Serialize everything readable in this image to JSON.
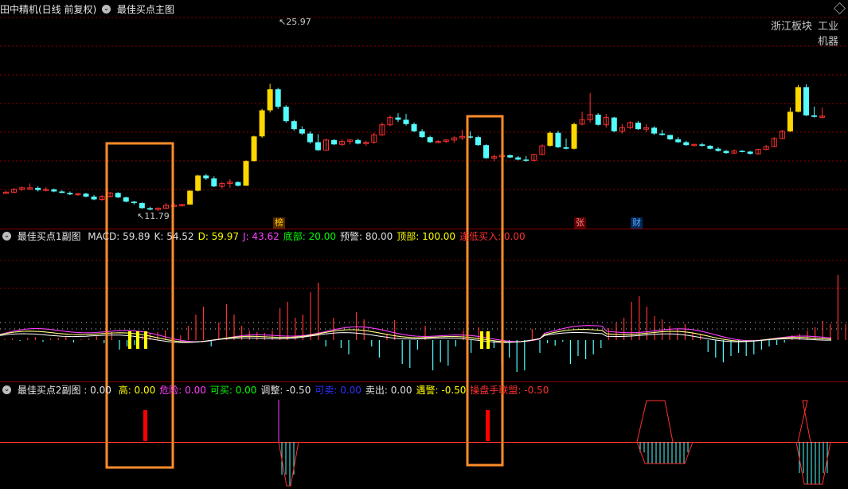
{
  "main_header": {
    "stock": "田中精机(日线 前复权)",
    "indicator": "最佳买点主图"
  },
  "labels": {
    "high": "25.97",
    "low": "11.79",
    "right_a": "浙江板块",
    "right_b": "工业机器"
  },
  "tags": {
    "bang": "榜",
    "zhang": "张",
    "cai": "财"
  },
  "sub1": {
    "name": "最佳买点1副图",
    "items": [
      {
        "label": "MACD: 59.89",
        "color": "#e0e0e0"
      },
      {
        "label": "K: 54.52",
        "color": "#e0e0e0"
      },
      {
        "label": "D: 59.97",
        "color": "#ffff00"
      },
      {
        "label": "J: 43.62",
        "color": "#ff40ff"
      },
      {
        "label": "底部: 20.00",
        "color": "#00ff00"
      },
      {
        "label": "预警: 80.00",
        "color": "#e0e0e0"
      },
      {
        "label": "顶部: 100.00",
        "color": "#ffff00"
      },
      {
        "label": "逢低买入: 0.00",
        "color": "#ff3030"
      }
    ]
  },
  "sub2": {
    "name": "最佳买点2副图 : 0.00",
    "items": [
      {
        "label": "高: 0.00",
        "color": "#ffff00"
      },
      {
        "label": "危险: 0.00",
        "color": "#ff40ff"
      },
      {
        "label": "可买: 0.00",
        "color": "#00ff00"
      },
      {
        "label": "调整: -0.50",
        "color": "#e0e0e0"
      },
      {
        "label": "可卖: 0.00",
        "color": "#3030ff"
      },
      {
        "label": "卖出: 0.00",
        "color": "#e0e0e0"
      },
      {
        "label": "遇警: -0.50",
        "color": "#ffff00"
      },
      {
        "label": "操盘手联盟: -0.50",
        "color": "#ff3030"
      }
    ]
  },
  "colors": {
    "up": "#ff3030",
    "down": "#54fcfc",
    "bigUp": "#ffd700",
    "box": "#ff8c2a",
    "grid": "#8b0000"
  },
  "candles": [
    [
      10.9,
      11.2,
      10.8,
      11.0
    ],
    [
      11.0,
      11.6,
      10.9,
      11.4
    ],
    [
      11.4,
      11.8,
      11.2,
      11.6
    ],
    [
      11.6,
      12.2,
      11.5,
      11.6
    ],
    [
      11.6,
      11.8,
      11.1,
      11.3
    ],
    [
      11.3,
      11.7,
      11.1,
      11.4
    ],
    [
      11.4,
      11.5,
      11.0,
      11.1
    ],
    [
      11.1,
      11.3,
      10.9,
      10.9
    ],
    [
      10.9,
      11.1,
      10.6,
      10.7
    ],
    [
      10.7,
      10.9,
      10.5,
      10.8
    ],
    [
      10.8,
      10.9,
      10.3,
      10.4
    ],
    [
      10.4,
      10.6,
      9.9,
      10.0
    ],
    [
      10.0,
      10.6,
      9.8,
      10.4
    ],
    [
      10.4,
      11.0,
      10.3,
      10.9
    ],
    [
      10.9,
      11.0,
      10.2,
      10.3
    ],
    [
      10.3,
      10.4,
      9.6,
      9.7
    ],
    [
      9.7,
      9.8,
      9.3,
      9.5
    ],
    [
      9.5,
      9.6,
      8.7,
      8.8
    ],
    [
      8.8,
      9.0,
      8.5,
      8.6
    ],
    [
      8.6,
      8.9,
      8.4,
      8.8
    ],
    [
      8.8,
      9.5,
      8.7,
      9.2
    ],
    [
      9.2,
      9.5,
      9.1,
      9.2
    ],
    [
      9.2,
      9.4,
      9.0,
      9.3
    ],
    [
      9.3,
      11.3,
      9.3,
      11.2
    ],
    [
      11.2,
      13.4,
      11.1,
      13.3
    ],
    [
      13.3,
      13.5,
      12.7,
      12.9
    ],
    [
      12.9,
      13.2,
      11.7,
      11.8
    ],
    [
      11.8,
      12.4,
      11.5,
      12.2
    ],
    [
      12.2,
      12.8,
      11.6,
      12.4
    ],
    [
      12.4,
      12.5,
      11.8,
      11.9
    ],
    [
      11.9,
      15.4,
      11.9,
      15.3
    ],
    [
      15.3,
      18.8,
      15.2,
      18.7
    ],
    [
      18.7,
      22.5,
      18.5,
      22.3
    ],
    [
      22.3,
      25.97,
      22.0,
      25.2
    ],
    [
      25.2,
      25.4,
      22.5,
      22.8
    ],
    [
      22.8,
      23.0,
      20.6,
      20.8
    ],
    [
      20.8,
      21.0,
      19.5,
      19.7
    ],
    [
      19.7,
      20.1,
      18.9,
      19.1
    ],
    [
      19.1,
      19.4,
      17.7,
      17.9
    ],
    [
      17.9,
      19.0,
      16.7,
      16.8
    ],
    [
      16.8,
      18.4,
      16.8,
      18.2
    ],
    [
      18.2,
      18.3,
      17.5,
      17.6
    ],
    [
      17.6,
      18.3,
      17.4,
      18.0
    ],
    [
      18.0,
      18.3,
      17.6,
      18.2
    ],
    [
      18.2,
      18.4,
      17.6,
      17.7
    ],
    [
      17.7,
      18.1,
      17.4,
      17.9
    ],
    [
      17.9,
      19.2,
      17.7,
      18.9
    ],
    [
      18.9,
      20.6,
      18.8,
      20.3
    ],
    [
      20.3,
      21.6,
      20.1,
      21.3
    ],
    [
      21.3,
      21.9,
      20.7,
      21.0
    ],
    [
      21.0,
      21.8,
      20.2,
      20.4
    ],
    [
      20.4,
      20.6,
      19.3,
      19.4
    ],
    [
      19.4,
      19.7,
      18.5,
      18.6
    ],
    [
      18.6,
      18.8,
      17.8,
      17.9
    ],
    [
      17.9,
      18.2,
      17.8,
      18.0
    ],
    [
      18.0,
      18.3,
      17.8,
      18.2
    ],
    [
      18.2,
      18.7,
      17.8,
      18.5
    ],
    [
      18.5,
      19.6,
      18.2,
      18.7
    ],
    [
      18.7,
      19.4,
      18.4,
      18.6
    ],
    [
      18.6,
      18.8,
      17.4,
      17.5
    ],
    [
      17.5,
      17.6,
      15.6,
      15.7
    ],
    [
      15.7,
      16.2,
      15.3,
      15.9
    ],
    [
      15.9,
      16.4,
      15.7,
      16.1
    ],
    [
      16.1,
      16.2,
      15.7,
      15.8
    ],
    [
      15.8,
      16.0,
      15.4,
      15.5
    ],
    [
      15.5,
      16.0,
      15.2,
      15.4
    ],
    [
      15.4,
      16.3,
      15.3,
      16.2
    ],
    [
      16.2,
      17.6,
      16.1,
      17.4
    ],
    [
      17.4,
      19.4,
      17.3,
      19.2
    ],
    [
      19.2,
      19.5,
      17.1,
      17.2
    ],
    [
      17.2,
      18.4,
      16.9,
      17.0
    ],
    [
      17.0,
      20.6,
      16.9,
      20.4
    ],
    [
      20.4,
      22.1,
      20.2,
      21.0
    ],
    [
      21.0,
      24.7,
      20.6,
      21.7
    ],
    [
      21.7,
      21.9,
      20.2,
      20.3
    ],
    [
      20.3,
      21.8,
      19.9,
      21.3
    ],
    [
      21.3,
      21.4,
      19.3,
      19.4
    ],
    [
      19.4,
      20.4,
      19.1,
      19.9
    ],
    [
      19.9,
      20.8,
      19.7,
      20.6
    ],
    [
      20.6,
      20.8,
      19.6,
      19.7
    ],
    [
      19.7,
      20.4,
      19.3,
      19.9
    ],
    [
      19.9,
      20.1,
      18.9,
      19.1
    ],
    [
      19.1,
      19.6,
      18.8,
      18.9
    ],
    [
      18.9,
      18.9,
      18.2,
      18.3
    ],
    [
      18.3,
      18.6,
      17.8,
      17.9
    ],
    [
      17.9,
      18.1,
      17.4,
      17.5
    ],
    [
      17.5,
      17.7,
      17.3,
      17.6
    ],
    [
      17.6,
      17.8,
      17.3,
      17.4
    ],
    [
      17.4,
      17.5,
      16.9,
      17.0
    ],
    [
      17.0,
      17.2,
      16.6,
      16.7
    ],
    [
      16.7,
      16.8,
      16.3,
      16.4
    ],
    [
      16.4,
      16.9,
      16.3,
      16.7
    ],
    [
      16.7,
      16.8,
      16.5,
      16.6
    ],
    [
      16.6,
      16.7,
      16.2,
      16.3
    ],
    [
      16.3,
      17.0,
      16.2,
      16.9
    ],
    [
      16.9,
      17.5,
      16.8,
      17.3
    ],
    [
      17.3,
      18.6,
      17.2,
      18.4
    ],
    [
      18.4,
      19.6,
      18.3,
      19.4
    ],
    [
      19.4,
      22.7,
      19.3,
      22.1
    ],
    [
      22.1,
      25.8,
      22.0,
      25.5
    ],
    [
      25.5,
      25.9,
      21.5,
      21.6
    ],
    [
      21.6,
      22.8,
      21.3,
      21.4
    ],
    [
      21.4,
      22.7,
      21.2,
      21.5
    ]
  ],
  "sub1_bars": [
    1,
    2,
    -1,
    3,
    4,
    -2,
    2,
    3,
    5,
    -3,
    1,
    2,
    6,
    -4,
    10,
    -12,
    -8,
    -6,
    5,
    8,
    10,
    12,
    15,
    6,
    18,
    32,
    42,
    -8,
    22,
    45,
    32,
    18,
    12,
    10,
    9,
    12,
    40,
    48,
    28,
    32,
    60,
    72,
    -8,
    28,
    -10,
    -18,
    35,
    26,
    -8,
    -22,
    8,
    25,
    -30,
    -35,
    -12,
    18,
    -38,
    -28,
    -32,
    -8,
    12,
    -16,
    16,
    10,
    -10,
    -32,
    -22,
    -40,
    -38,
    14,
    -16,
    -4,
    -7,
    -2,
    -30,
    -20,
    -24,
    -18,
    -10,
    15,
    22,
    28,
    48,
    55,
    42,
    30,
    26,
    18,
    14,
    20,
    10,
    8,
    -15,
    -22,
    -28,
    -20,
    -16,
    -20,
    -18,
    -12,
    -8,
    -6,
    -3,
    6,
    8,
    12,
    16,
    24,
    20,
    82,
    20,
    32,
    -12,
    16,
    10
  ],
  "sub2_down": [
    [
      350,
      555,
      375,
      610
    ],
    [
      800,
      555,
      870,
      582
    ],
    [
      1000,
      555,
      1043,
      608
    ]
  ]
}
